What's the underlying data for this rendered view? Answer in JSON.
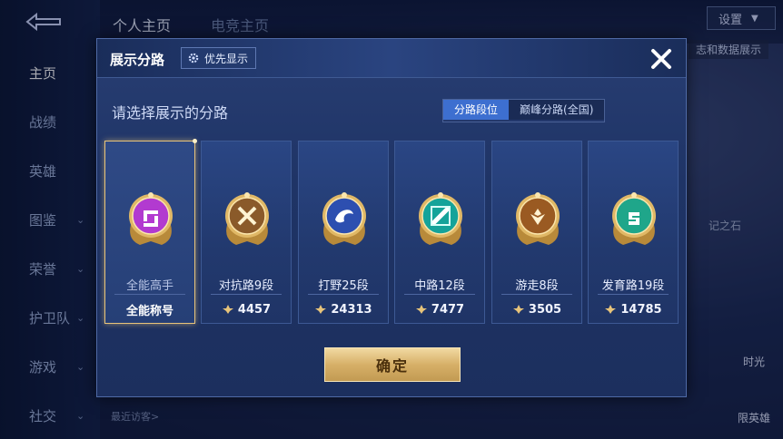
{
  "background": {
    "sidebar_items": [
      {
        "label": "主页",
        "active": true,
        "has_chevron": false
      },
      {
        "label": "战绩",
        "active": false,
        "has_chevron": false
      },
      {
        "label": "英雄",
        "active": false,
        "has_chevron": false
      },
      {
        "label": "图鉴",
        "active": false,
        "has_chevron": true
      },
      {
        "label": "荣誉",
        "active": false,
        "has_chevron": true
      },
      {
        "label": "护卫队",
        "active": false,
        "has_chevron": true
      },
      {
        "label": "游戏",
        "active": false,
        "has_chevron": true
      },
      {
        "label": "社交",
        "active": false,
        "has_chevron": true
      }
    ],
    "top_tabs": [
      "个人主页",
      "电竞主页"
    ],
    "settings_label": "设置",
    "showcase_label": "志和数据展示",
    "side_text": "记之石",
    "recent_visitors_label": "最近访客>",
    "right_button_1": "时光",
    "right_button_2": "限英雄"
  },
  "dialog": {
    "title": "展示分路",
    "priority_button": "优先显示",
    "subtitle": "请选择展示的分路",
    "segments": [
      {
        "label": "分路段位",
        "active": true
      },
      {
        "label": "巅峰分路(全国)",
        "active": false
      }
    ],
    "cards": [
      {
        "rank": "全能高手",
        "score": null,
        "label": "全能称号",
        "selected": true,
        "badge_color": "#b23ad0",
        "glyph": "allround"
      },
      {
        "rank": "对抗路9段",
        "score": "4457",
        "label": null,
        "selected": false,
        "badge_color": "#8a5a2a",
        "glyph": "clash"
      },
      {
        "rank": "打野25段",
        "score": "24313",
        "label": null,
        "selected": false,
        "badge_color": "#2d4fb0",
        "glyph": "jungle"
      },
      {
        "rank": "中路12段",
        "score": "7477",
        "label": null,
        "selected": false,
        "badge_color": "#15a39a",
        "glyph": "mid"
      },
      {
        "rank": "游走8段",
        "score": "3505",
        "label": null,
        "selected": false,
        "badge_color": "#9a5a22",
        "glyph": "roam"
      },
      {
        "rank": "发育路19段",
        "score": "14785",
        "label": null,
        "selected": false,
        "badge_color": "#1fa68a",
        "glyph": "farm"
      }
    ],
    "confirm_label": "确定"
  },
  "colors": {
    "accent_gold": "#e8c47a",
    "segment_active": "#3d6fd0"
  }
}
